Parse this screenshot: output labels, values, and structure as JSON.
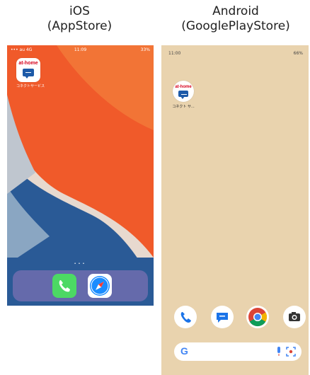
{
  "ios": {
    "caption_line1": "iOS",
    "caption_line2": "(AppStore)",
    "status_left": "••• au 4G",
    "status_time": "11:09",
    "status_right": "33%",
    "app_brand": "at-home",
    "app_label": "コネクトサービス",
    "page_dots": "•••",
    "dock": [
      "phone-icon",
      "safari-icon"
    ]
  },
  "android": {
    "caption_line1": "Android",
    "caption_line2": "(GooglePlayStore)",
    "status_time": "11:00",
    "status_right": "66%",
    "app_brand": "at-home",
    "app_label": "コネクト サ...",
    "dock": [
      "phone-icon",
      "messages-icon",
      "chrome-icon",
      "camera-icon"
    ],
    "search_logo": "G"
  },
  "colors": {
    "ios_orange": "#f05a2a",
    "ios_blue": "#1f4f8a",
    "android_bg": "#e9d3ae",
    "brand_red": "#d6001c",
    "brand_blue": "#1d5aa8"
  }
}
